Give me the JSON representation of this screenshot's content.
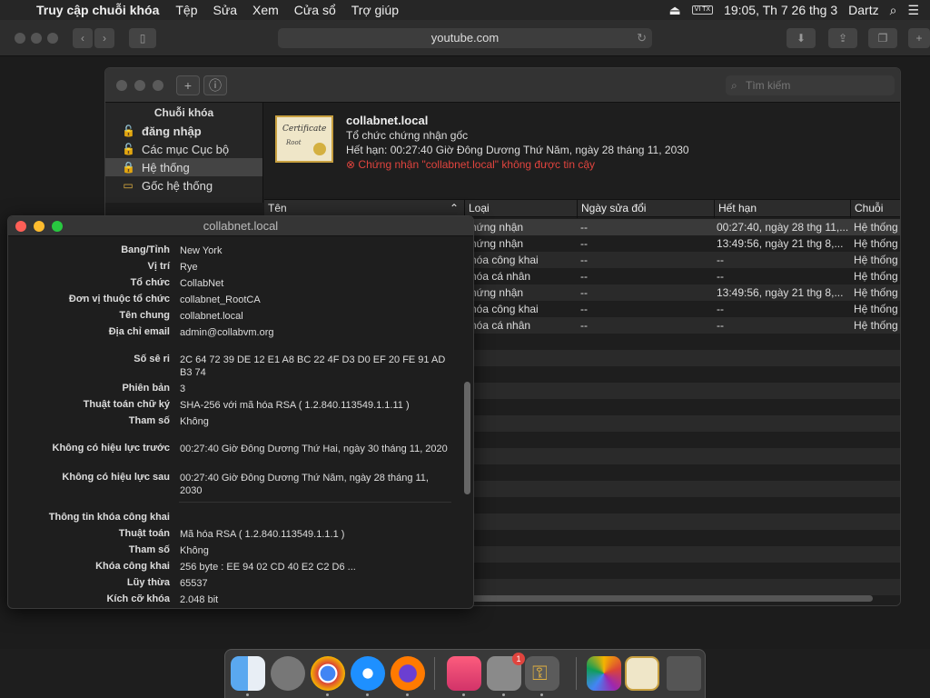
{
  "menubar": {
    "app": "Truy cập chuỗi khóa",
    "items": [
      "Tệp",
      "Sửa",
      "Xem",
      "Cửa sổ",
      "Trợ giúp"
    ],
    "input_badge": "VI TX",
    "clock": "19:05, Th 7 26 thg 3",
    "user": "Dartz"
  },
  "safari": {
    "url": "youtube.com"
  },
  "keychain": {
    "search_placeholder": "Tìm kiếm",
    "sidebar_header": "Chuỗi khóa",
    "sidebar_items": [
      {
        "label": "đăng nhập",
        "bold": true
      },
      {
        "label": "Các mục Cục bộ"
      },
      {
        "label": "Hệ thống",
        "selected": true
      },
      {
        "label": "Gốc hệ thống"
      }
    ],
    "cert": {
      "name": "collabnet.local",
      "type": "Tổ chức chứng nhận gốc",
      "expires": "Hết hạn: 00:27:40 Giờ Đông Dương Thứ Năm, ngày 28 tháng 11, 2030",
      "warning": "Chứng nhận \"collabnet.local\" không được tin cậy",
      "image_title": "Certificate",
      "image_sub": "Root"
    },
    "columns": [
      "Tên",
      "Loại",
      "Ngày sửa đổi",
      "Hết hạn",
      "Chuỗi khó"
    ],
    "rows": [
      {
        "type": "hứng nhận",
        "modified": "--",
        "expires": "00:27:40, ngày 28 thg 11,...",
        "keychain": "Hệ thống",
        "selected": true
      },
      {
        "type": "hứng nhận",
        "modified": "--",
        "expires": "13:49:56, ngày 21 thg 8,...",
        "keychain": "Hệ thống"
      },
      {
        "type": "hóa công khai",
        "modified": "--",
        "expires": "--",
        "keychain": "Hệ thống"
      },
      {
        "type": "hóa cá nhân",
        "modified": "--",
        "expires": "--",
        "keychain": "Hệ thống"
      },
      {
        "type": "hứng nhận",
        "modified": "--",
        "expires": "13:49:56, ngày 21 thg 8,...",
        "keychain": "Hệ thống"
      },
      {
        "type": "hóa công khai",
        "modified": "--",
        "expires": "--",
        "keychain": "Hệ thống"
      },
      {
        "type": "hóa cá nhân",
        "modified": "--",
        "expires": "--",
        "keychain": "Hệ thống"
      }
    ]
  },
  "detail": {
    "title": "collabnet.local",
    "fields": {
      "state_k": "Bang/Tỉnh",
      "state_v": "New York",
      "loc_k": "Vị trí",
      "loc_v": "Rye",
      "org_k": "Tổ chức",
      "org_v": "CollabNet",
      "ou_k": "Đơn vị thuộc tổ chức",
      "ou_v": "collabnet_RootCA",
      "cn_k": "Tên chung",
      "cn_v": "collabnet.local",
      "email_k": "Địa chỉ email",
      "email_v": "admin@collabvm.org",
      "serial_k": "Số sê ri",
      "serial_v": "2C 64 72 39 DE 12 E1 A8 BC 22 4F D3 D0 EF 20 FE 91 AD B3 74",
      "ver_k": "Phiên bản",
      "ver_v": "3",
      "sigalg_k": "Thuật toán chữ ký",
      "sigalg_v": "SHA-256 với mã hóa RSA ( 1.2.840.113549.1.1.11 )",
      "param_k": "Tham số",
      "param_v": "Không",
      "nb_k": "Không có hiệu lực trước",
      "nb_v": "00:27:40 Giờ Đông Dương Thứ Hai, ngày 30 tháng 11, 2020",
      "na_k": "Không có hiệu lực sau",
      "na_v": "00:27:40 Giờ Đông Dương Thứ Năm, ngày 28 tháng 11, 2030",
      "pk_section": "Thông tin khóa công khai",
      "alg_k": "Thuật toán",
      "alg_v": "Mã hóa RSA ( 1.2.840.113549.1.1.1 )",
      "param2_k": "Tham số",
      "param2_v": "Không",
      "pub_k": "Khóa công khai",
      "pub_v": "256 byte : EE 94 02 CD 40 E2 C2 D6 ...",
      "exp_k": "Lũy thừa",
      "exp_v": "65537",
      "size_k": "Kích cỡ khóa",
      "size_v": "2.048 bit"
    }
  },
  "dock_badge": "1"
}
